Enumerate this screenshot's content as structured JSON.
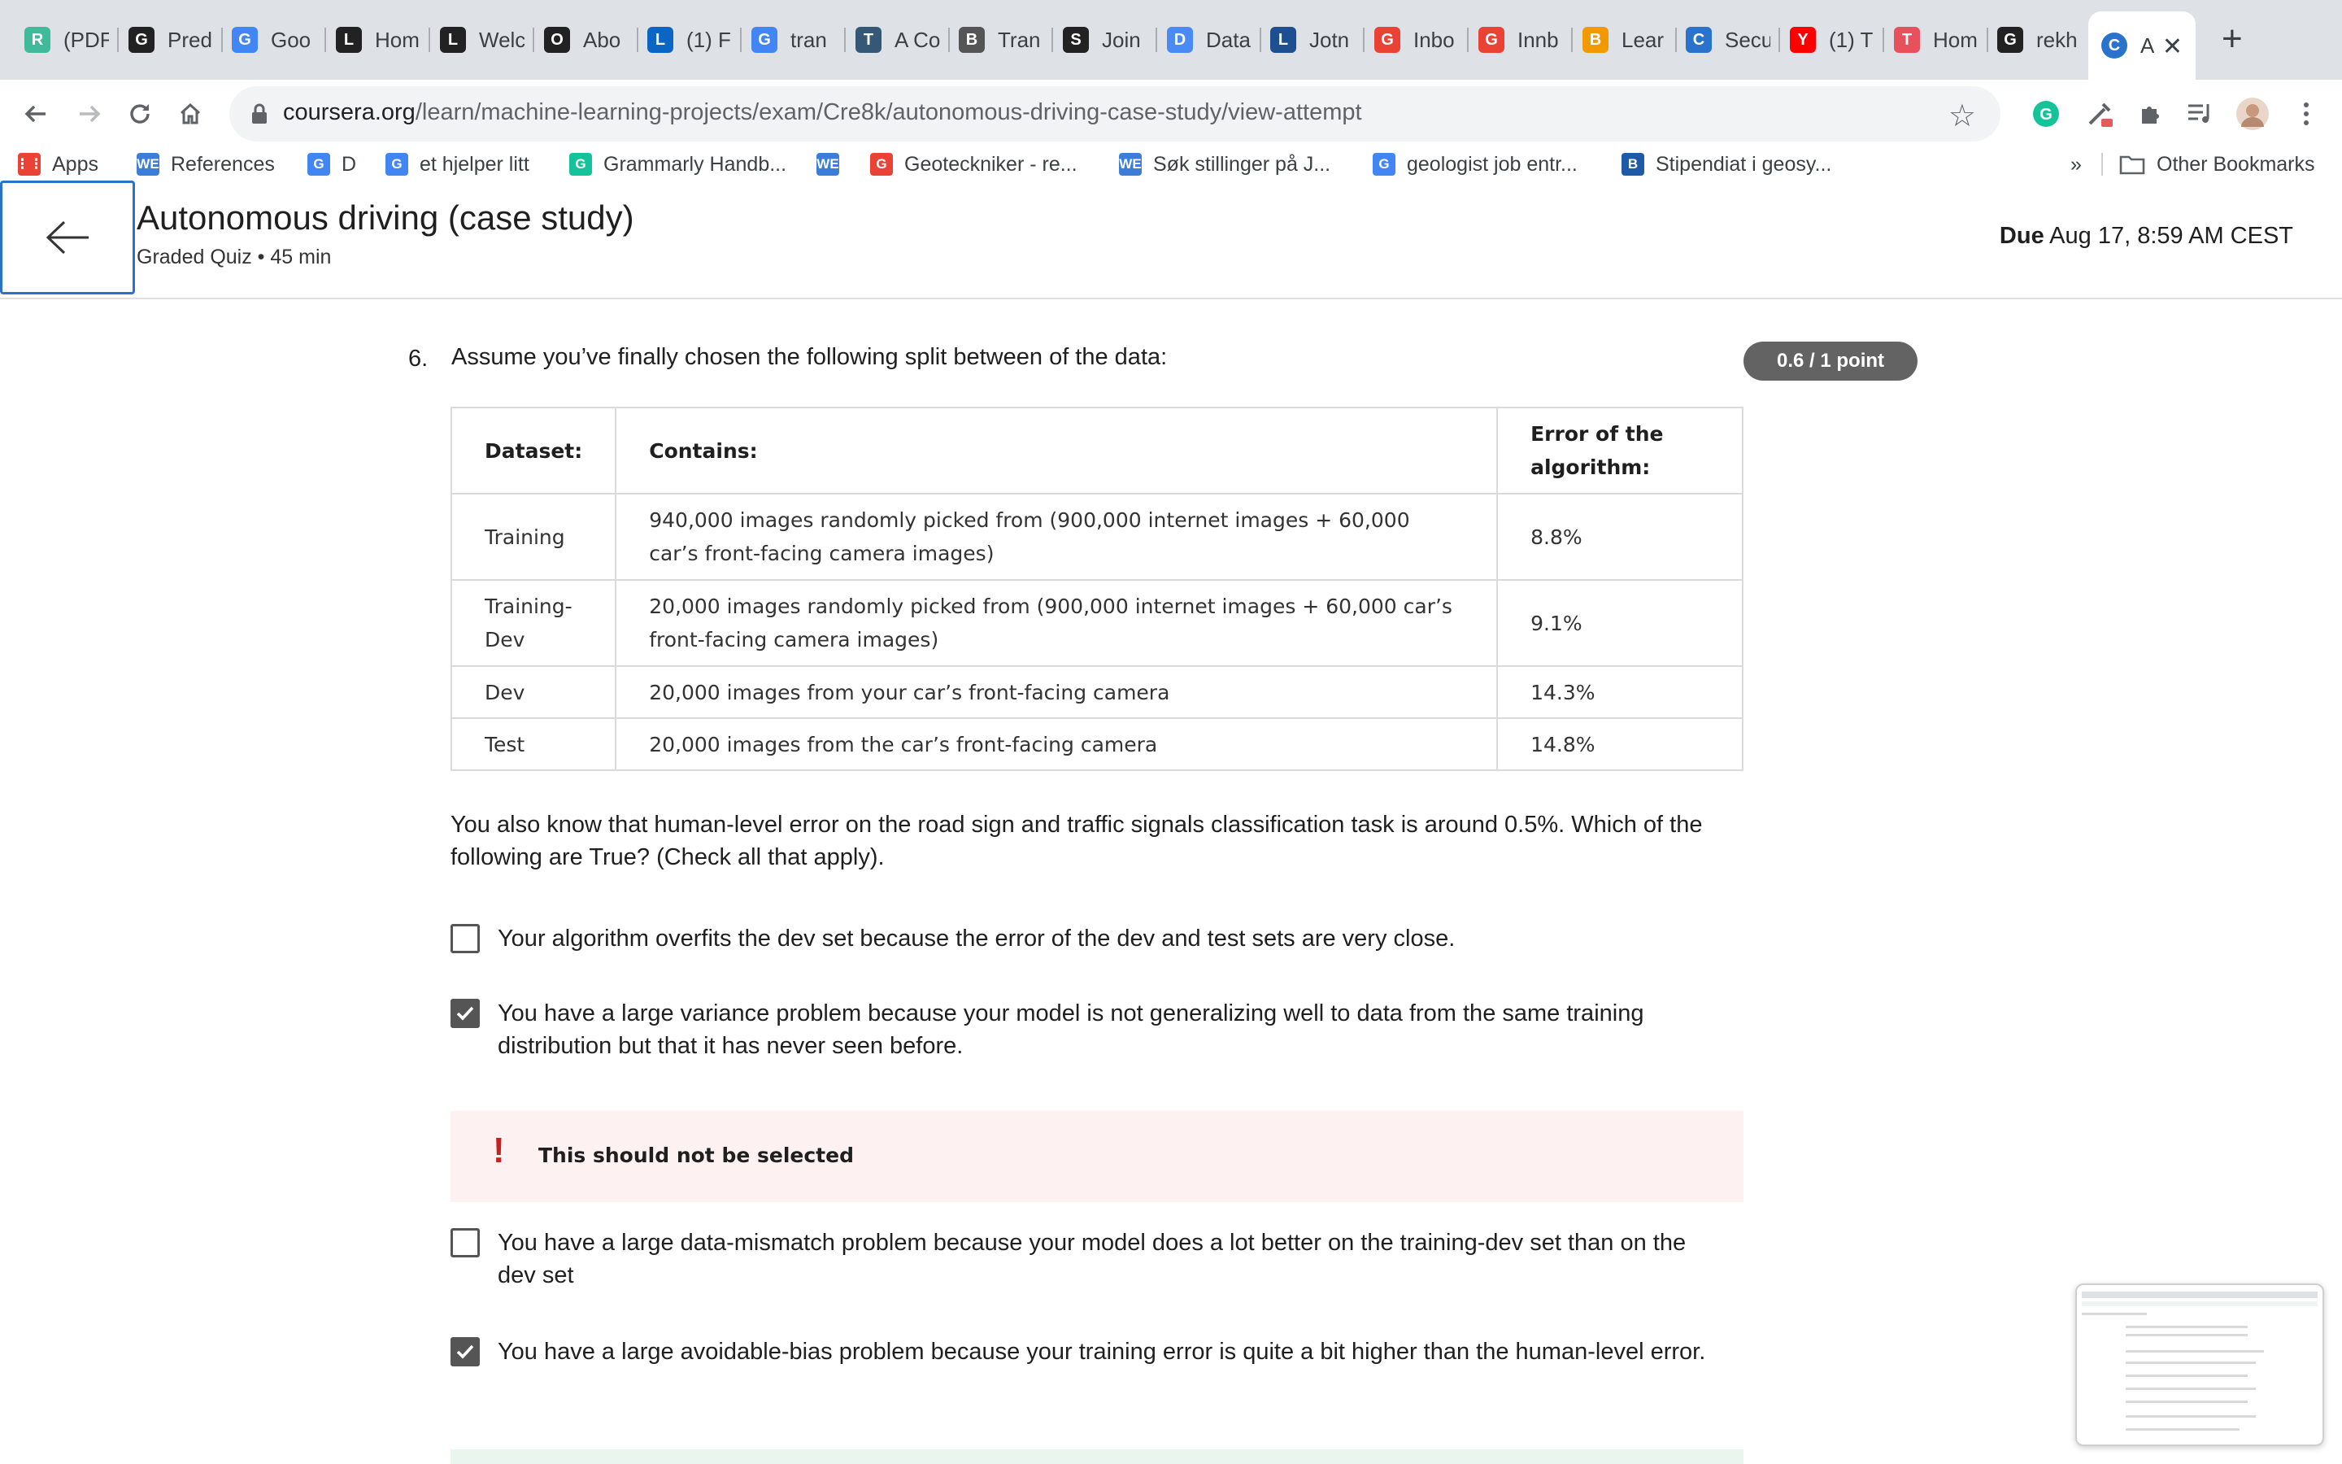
{
  "browser": {
    "tabs": [
      {
        "label": "(PDF",
        "icon": "researchgate-icon",
        "color": "#40ba9b"
      },
      {
        "label": "Pred",
        "icon": "gear-icon",
        "color": "#222222"
      },
      {
        "label": "Goo",
        "icon": "google-translate-icon",
        "color": "#4285f4"
      },
      {
        "label": "Hom",
        "icon": "letter-a-icon",
        "color": "#222222"
      },
      {
        "label": "Welc",
        "icon": "letter-a-icon",
        "color": "#222222"
      },
      {
        "label": "Abo",
        "icon": "openai-icon",
        "color": "#222222"
      },
      {
        "label": "(1) F",
        "icon": "linkedin-icon",
        "color": "#0a66c2"
      },
      {
        "label": "tran",
        "icon": "google-icon",
        "color": "#4285f4"
      },
      {
        "label": "A Co",
        "icon": "tds-icon",
        "color": "#355876"
      },
      {
        "label": "Tran",
        "icon": "bicycle-icon",
        "color": "#555555"
      },
      {
        "label": "Join",
        "icon": "script-s-icon",
        "color": "#222222"
      },
      {
        "label": "Data",
        "icon": "drop-icon",
        "color": "#4a8af4"
      },
      {
        "label": "Jotn",
        "icon": "letter-j-icon",
        "color": "#1d4f91"
      },
      {
        "label": "Inbo",
        "icon": "gmail-icon",
        "color": "#ea4335"
      },
      {
        "label": "Innb",
        "icon": "gmail-icon",
        "color": "#ea4335"
      },
      {
        "label": "Lear",
        "icon": "bars-icon",
        "color": "#f29900"
      },
      {
        "label": "Secu",
        "icon": "coursera-icon",
        "color": "#2a73cc"
      },
      {
        "label": "(1) T",
        "icon": "youtube-icon",
        "color": "#ff0000"
      },
      {
        "label": "Hom",
        "icon": "target-icon",
        "color": "#e8505b"
      },
      {
        "label": "rekh",
        "icon": "github-icon",
        "color": "#222222"
      },
      {
        "label": "A",
        "icon": "coursera-icon",
        "color": "#2a73cc",
        "active": true
      }
    ],
    "url_domain": "coursera.org",
    "url_path": "/learn/machine-learning-projects/exam/Cre8k/autonomous-driving-case-study/view-attempt",
    "bookmarks": [
      {
        "label": "Apps",
        "icon": "apps-grid-icon",
        "color": "#ea4335"
      },
      {
        "label": "References",
        "icon": "we-icon",
        "color": "#3b7dd8"
      },
      {
        "label": "D",
        "icon": "google-icon",
        "color": "#4285f4"
      },
      {
        "label": "et hjelper litt",
        "icon": "google-translate-icon",
        "color": "#4285f4"
      },
      {
        "label": "Grammarly Handb...",
        "icon": "grammarly-icon",
        "color": "#15c39a"
      },
      {
        "label": "",
        "icon": "we-icon",
        "color": "#3b7dd8"
      },
      {
        "label": "Geoteckniker - re...",
        "icon": "gmail-icon",
        "color": "#ea4335"
      },
      {
        "label": "Søk stillinger på J...",
        "icon": "we-icon",
        "color": "#3b7dd8"
      },
      {
        "label": "geologist job entr...",
        "icon": "google-icon",
        "color": "#4285f4"
      },
      {
        "label": "Stipendiat i geosy...",
        "icon": "bookmark-blue-icon",
        "color": "#1e5aa8"
      }
    ],
    "bookmarks_overflow": "»",
    "other_bookmarks": "Other Bookmarks"
  },
  "header": {
    "title": "Autonomous driving (case study)",
    "subtitle": "Graded Quiz • 45 min",
    "due_label": "Due",
    "due_value": "Aug 17, 8:59 AM CEST"
  },
  "question": {
    "number": "6.",
    "text": "Assume you’ve finally chosen the following split between of the data:",
    "points": "0.6 / 1 point",
    "table": {
      "headers": [
        "Dataset:",
        "Contains:",
        "Error of the algorithm:"
      ],
      "rows": [
        [
          "Training",
          "940,000 images randomly picked from (900,000 internet images + 60,000 car’s front-facing camera images)",
          "8.8%"
        ],
        [
          "Training-Dev",
          "20,000 images randomly picked from (900,000 internet images + 60,000 car’s front-facing camera images)",
          "9.1%"
        ],
        [
          "Dev",
          "20,000 images from your car’s front-facing camera",
          "14.3%"
        ],
        [
          "Test",
          "20,000 images from the car’s front-facing camera",
          "14.8%"
        ]
      ]
    },
    "prompt": "You also know that human-level error on the road sign and traffic signals classification task is around 0.5%. Which of the following are True? (Check all that apply).",
    "options": [
      {
        "text": "Your algorithm overfits the dev set because the error of the dev and test sets are very close.",
        "checked": false
      },
      {
        "text": "You have a large variance problem because your model is not generalizing well to data from the same training distribution but that it has never seen before.",
        "checked": true
      },
      {
        "text": "You have a large data-mismatch problem because your model does a lot better on the training-dev set than on the dev set",
        "checked": false
      },
      {
        "text": "You have a large avoidable-bias problem because your training error is quite a bit higher than the human-level error.",
        "checked": true
      }
    ],
    "feedback_icon": "!",
    "feedback_text": "This should not be selected"
  }
}
